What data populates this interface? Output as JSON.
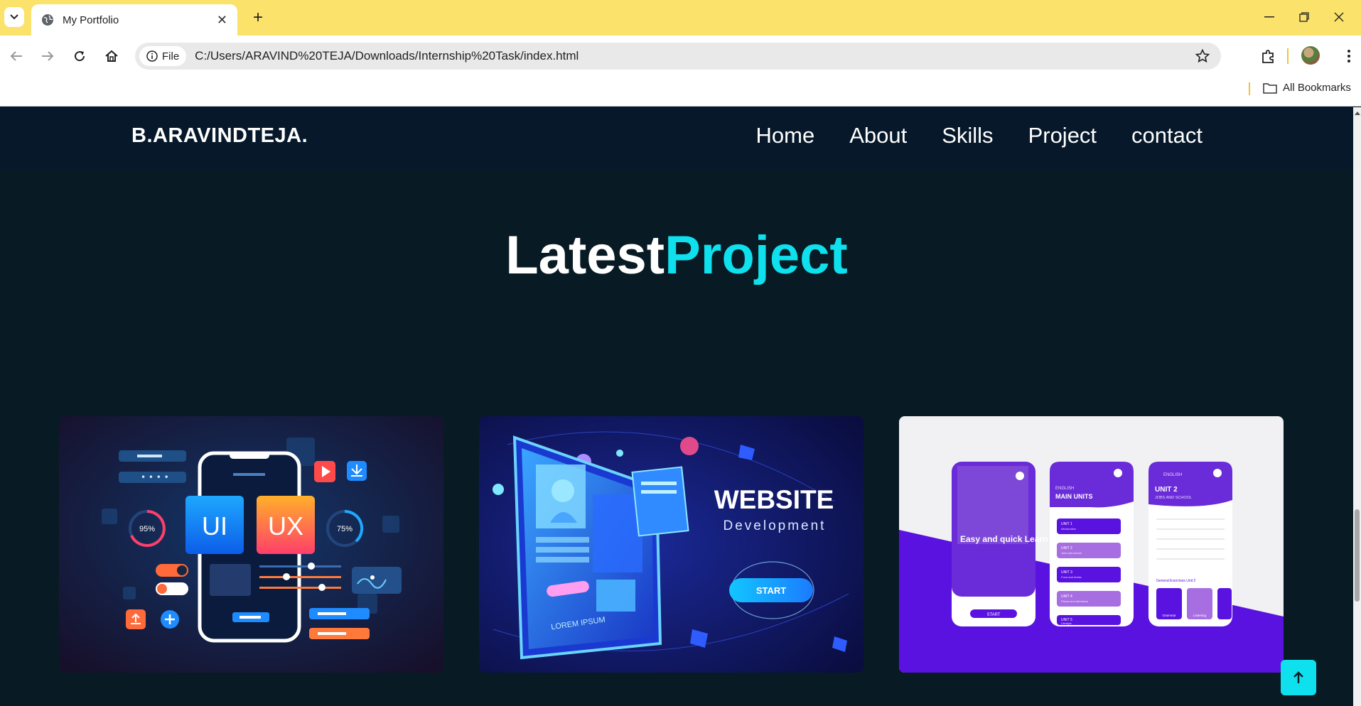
{
  "browser": {
    "tab_title": "My Portfolio",
    "file_chip": "File",
    "url": "C:/Users/ARAVIND%20TEJA/Downloads/Internship%20Task/index.html",
    "bookmarks_label": "All Bookmarks",
    "accent": "#fbe26b"
  },
  "site": {
    "logo": "B.ARAVINDTEJA.",
    "nav": [
      "Home",
      "About",
      "Skills",
      "Project",
      "contact"
    ],
    "section_title_main": "Latest",
    "section_title_accent": "Project",
    "accent_color": "#0fe0ee",
    "background": "#081b24"
  },
  "projects": [
    {
      "name": "ui-ux-card",
      "texts": {
        "ui": "UI",
        "ux": "UX",
        "left_gauge": "95%",
        "right_gauge": "75%"
      }
    },
    {
      "name": "website-development-card",
      "texts": {
        "headline": "WEBSITE",
        "subline": "Development",
        "button": "START",
        "screen_caption": "LOREM IPSUM"
      }
    },
    {
      "name": "language-app-card",
      "texts": {
        "phone1_heading": "Easy and quick Learn Language online!",
        "phone1_button": "START",
        "phone2_top": "ENGLISH",
        "phone2_heading": "MAIN UNITS",
        "phone2_units": [
          "UNIT 1",
          "UNIT 2",
          "UNIT 3",
          "UNIT 4",
          "UNIT 5"
        ],
        "phone2_unit_subs": [
          "Introduction",
          "Jobs and school",
          "Food and drinks",
          "Places and directions",
          "Lifestyle"
        ],
        "phone3_top": "ENGLISH",
        "phone3_heading": "UNIT 2",
        "phone3_sub": "JOBS AND SCHOOL",
        "phone3_link": "General Exercises Unit 2",
        "phone3_tabs": [
          "Grammar",
          "Listening"
        ]
      }
    }
  ]
}
